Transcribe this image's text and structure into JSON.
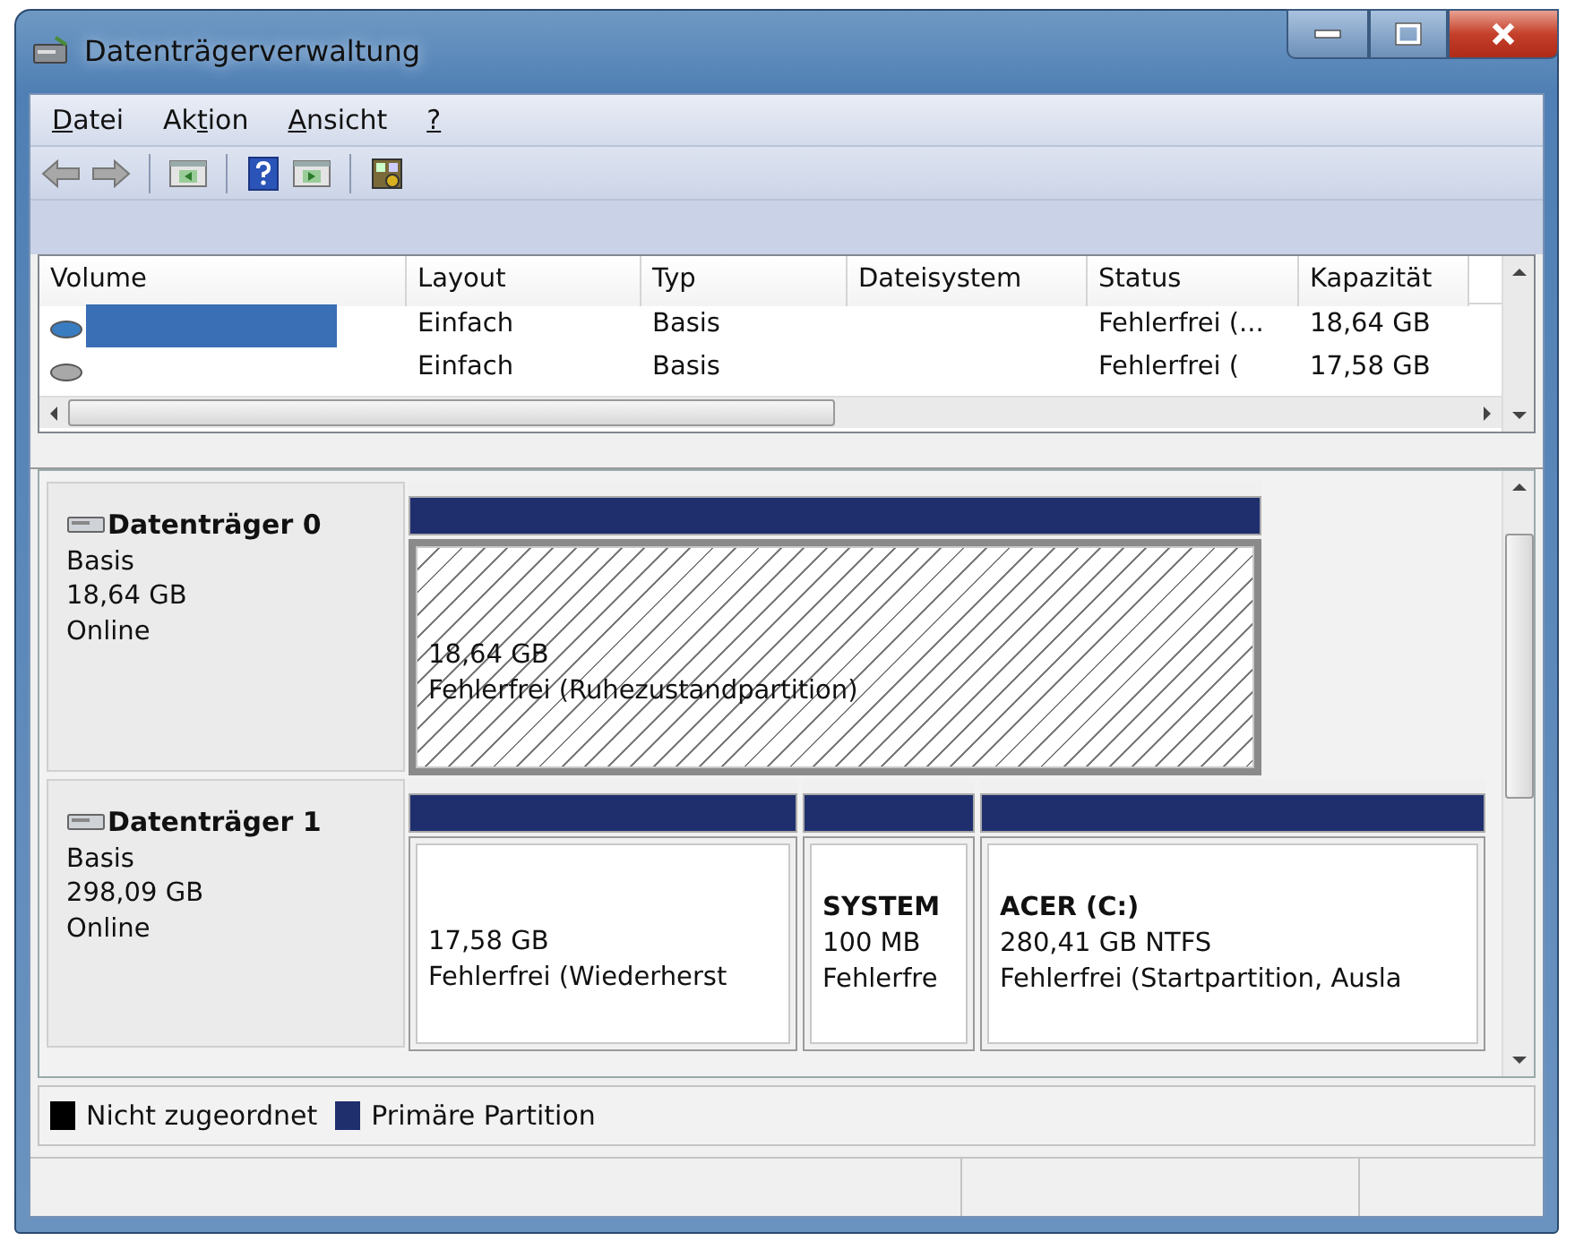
{
  "window": {
    "title": "Datenträgerverwaltung"
  },
  "menu": [
    {
      "parts": [
        {
          "text": "D",
          "underlined": true
        },
        {
          "text": "atei",
          "underlined": false
        }
      ]
    },
    {
      "parts": [
        {
          "text": "Ak",
          "underlined": false
        },
        {
          "text": "t",
          "underlined": true
        },
        {
          "text": "ion",
          "underlined": false
        }
      ]
    },
    {
      "parts": [
        {
          "text": "A",
          "underlined": true
        },
        {
          "text": "nsicht",
          "underlined": false
        }
      ]
    },
    {
      "parts": [
        {
          "text": "?",
          "underlined": true
        }
      ]
    }
  ],
  "volume_table": {
    "columns": [
      "Volume",
      "Layout",
      "Typ",
      "Dateisystem",
      "Status",
      "Kapazität"
    ],
    "rows": [
      {
        "name_redacted": true,
        "color": "#3a7cc0",
        "layout": "Einfach",
        "type": "Basis",
        "status": "Fehlerfrei (...",
        "capacity": "18,64 GB"
      },
      {
        "name_redacted": false,
        "color": "#a8a8a8",
        "layout": "Einfach",
        "type": "Basis",
        "status": "Fehlerfrei (",
        "capacity": "17,58 GB"
      }
    ]
  },
  "disks": [
    {
      "name": "Datenträger 0",
      "type": "Basis",
      "size": "18,64 GB",
      "state": "Online",
      "partitions": [
        {
          "selected": true,
          "size": "18,64 GB",
          "status": "Fehlerfrei (Ruhezustandpartition)"
        }
      ]
    },
    {
      "name": "Datenträger 1",
      "type": "Basis",
      "size": "298,09 GB",
      "state": "Online",
      "partitions": [
        {
          "selected": false,
          "size": "17,58 GB",
          "status": "Fehlerfrei (Wiederherst"
        },
        {
          "selected": false,
          "title": "SYSTEM",
          "size": "100 MB",
          "status": "Fehlerfre"
        },
        {
          "selected": false,
          "title": "ACER  (C:)",
          "size": "280,41 GB NTFS",
          "status": "Fehlerfrei (Startpartition, Ausla"
        }
      ]
    }
  ],
  "legend": [
    {
      "label": "Nicht zugeordnet",
      "color": "#000000"
    },
    {
      "label": "Primäre Partition",
      "color": "#1f2f6e"
    }
  ]
}
